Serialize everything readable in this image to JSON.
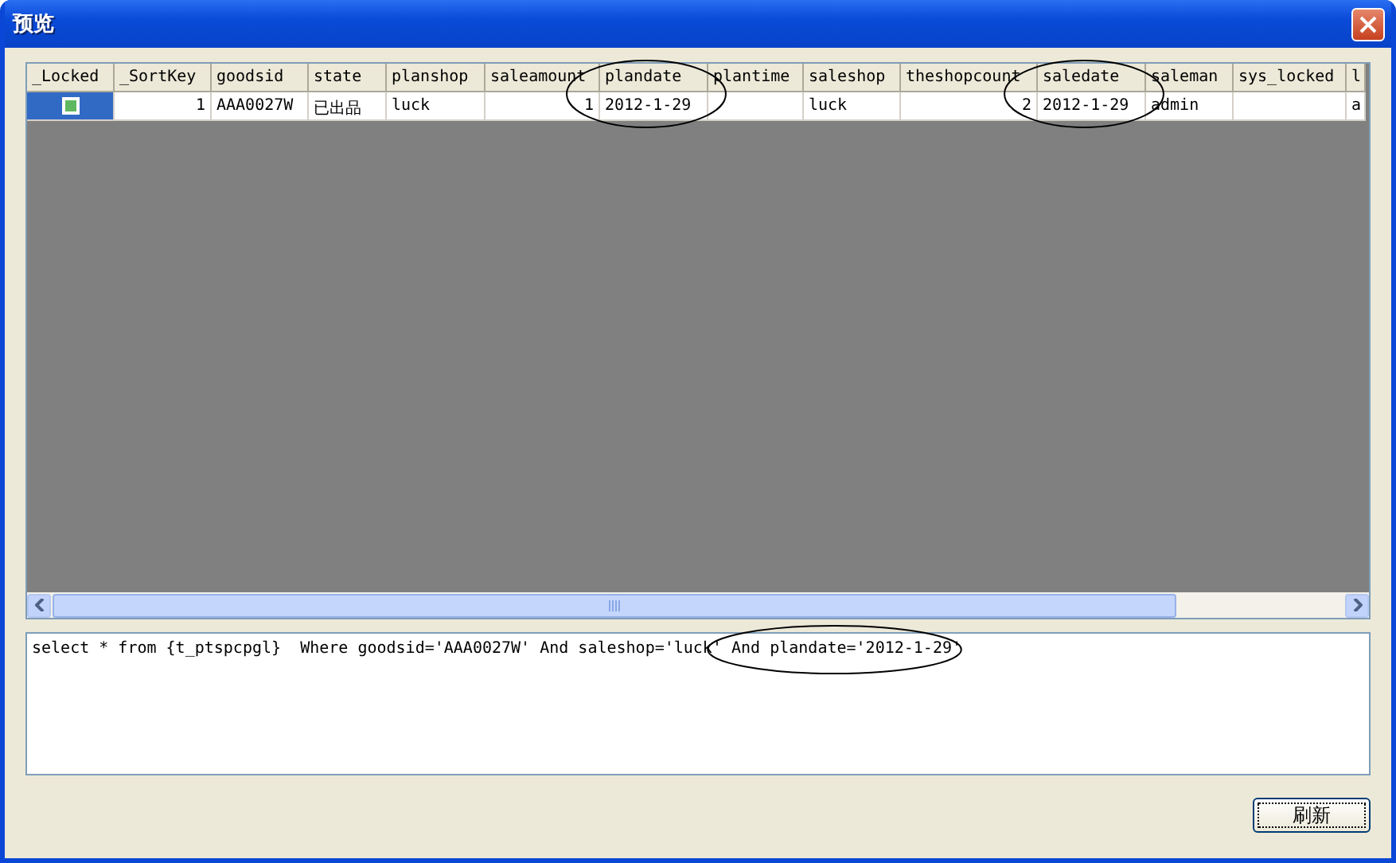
{
  "window": {
    "title": "预览"
  },
  "table": {
    "columns": [
      {
        "label": "_Locked",
        "circled": false
      },
      {
        "label": "_SortKey",
        "circled": false
      },
      {
        "label": "goodsid",
        "circled": false
      },
      {
        "label": "state",
        "circled": false
      },
      {
        "label": "planshop",
        "circled": false
      },
      {
        "label": "saleamount",
        "circled": false
      },
      {
        "label": "plandate",
        "circled": true
      },
      {
        "label": "plantime",
        "circled": false
      },
      {
        "label": "saleshop",
        "circled": false
      },
      {
        "label": "theshopcount",
        "circled": false
      },
      {
        "label": "saledate",
        "circled": true
      },
      {
        "label": "saleman",
        "circled": false
      },
      {
        "label": "sys_locked",
        "circled": false
      },
      {
        "label": "l",
        "circled": false
      }
    ],
    "rows": [
      {
        "selected": true,
        "locked": true,
        "cells": [
          "",
          "1",
          "AAA0027W",
          "已出品",
          "luck",
          "1",
          "2012-1-29",
          "",
          "luck",
          "2",
          "2012-1-29",
          "admin",
          "",
          "a"
        ]
      }
    ]
  },
  "sql": {
    "text": "select * from {t_ptspcpgl}  Where goodsid='AAA0027W' And saleshop='luck'",
    "circled_text": "And plandate='2012-1-29'"
  },
  "buttons": [
    {
      "label": "刷新"
    }
  ]
}
